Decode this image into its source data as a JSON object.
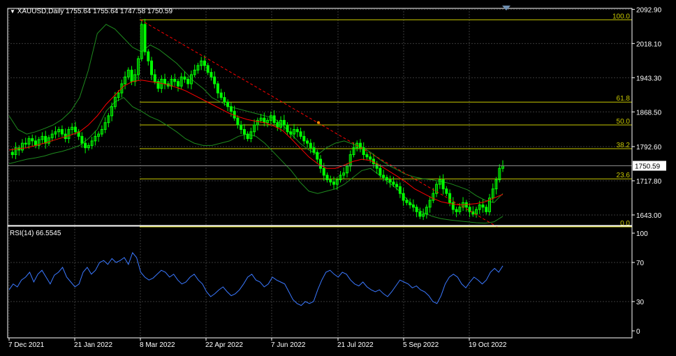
{
  "header": {
    "symbol_line": "XAUUSD,Daily  1755.64 1755.64 1747.58 1750.59",
    "menu_arrow": "▼"
  },
  "rsi_header": {
    "label": "RSI(14) 66.5545"
  },
  "colors": {
    "background": "#000000",
    "frame": "#ffffff",
    "grid": "#3a3a3a",
    "candle": "#00ff00",
    "ma": "#ff0000",
    "bands": "#1e8a1e",
    "fib": "#c8c800",
    "fib_label": "#c8c800",
    "trend": "#ff0000",
    "rsi": "#3a78ff",
    "price_box": "#ffffff",
    "text": "#ffffff"
  },
  "chart_data": [
    {
      "type": "candlestick",
      "title": "XAUUSD,Daily",
      "ohlc_last": {
        "open": 1755.64,
        "high": 1755.64,
        "low": 1747.58,
        "close": 1750.59
      },
      "y_ticks": [
        2092.9,
        2018.1,
        1943.3,
        1868.5,
        1792.6,
        1717.8,
        1643.0
      ],
      "y_tick_labels": [
        "2092.90",
        "2018.10",
        "1943.30",
        "1868.50",
        "1792.60",
        "1717.80",
        "1643.00"
      ],
      "ylim": [
        1620,
        2095
      ],
      "x_tick_labels": [
        "7 Dec 2021",
        "21 Jan 2022",
        "8 Mar 2022",
        "22 Apr 2022",
        "7 Jun 2022",
        "21 Jul 2022",
        "5 Sep 2022",
        "19 Oct 2022"
      ],
      "current_price_label": "1750.59",
      "current_price": 1750.59,
      "fibonacci": [
        {
          "level": "100.0",
          "price": 2070
        },
        {
          "level": "61.8",
          "price": 1890
        },
        {
          "level": "50.0",
          "price": 1840
        },
        {
          "level": "38.2",
          "price": 1788
        },
        {
          "level": "23.6",
          "price": 1722
        },
        {
          "level": "0.0",
          "price": 1617
        }
      ],
      "close_path": [
        1780,
        1775,
        1790,
        1785,
        1800,
        1798,
        1810,
        1805,
        1795,
        1808,
        1815,
        1800,
        1812,
        1820,
        1825,
        1830,
        1820,
        1810,
        1830,
        1835,
        1825,
        1815,
        1800,
        1790,
        1795,
        1805,
        1815,
        1820,
        1830,
        1845,
        1860,
        1880,
        1900,
        1910,
        1930,
        1945,
        1960,
        1935,
        1950,
        1985,
        2060,
        2000,
        1980,
        1950,
        1935,
        1920,
        1940,
        1930,
        1925,
        1940,
        1935,
        1925,
        1945,
        1940,
        1930,
        1950,
        1960,
        1970,
        1980,
        1970,
        1955,
        1945,
        1930,
        1910,
        1900,
        1890,
        1880,
        1870,
        1855,
        1840,
        1830,
        1820,
        1810,
        1825,
        1840,
        1850,
        1855,
        1845,
        1850,
        1860,
        1845,
        1835,
        1850,
        1840,
        1825,
        1820,
        1830,
        1825,
        1815,
        1805,
        1800,
        1790,
        1780,
        1765,
        1745,
        1730,
        1720,
        1715,
        1710,
        1720,
        1730,
        1735,
        1750,
        1775,
        1790,
        1800,
        1790,
        1775,
        1770,
        1765,
        1755,
        1745,
        1730,
        1725,
        1720,
        1715,
        1710,
        1705,
        1690,
        1675,
        1670,
        1665,
        1660,
        1650,
        1640,
        1645,
        1660,
        1675,
        1690,
        1710,
        1720,
        1700,
        1690,
        1670,
        1655,
        1650,
        1660,
        1670,
        1660,
        1650,
        1645,
        1655,
        1665,
        1660,
        1650,
        1680,
        1700,
        1720,
        1745,
        1750.59
      ],
      "ma_path": [
        1785,
        1788,
        1790,
        1795,
        1800,
        1806,
        1812,
        1818,
        1825,
        1840,
        1860,
        1885,
        1905,
        1925,
        1935,
        1938,
        1935,
        1932,
        1928,
        1922,
        1915,
        1905,
        1895,
        1885,
        1875,
        1865,
        1858,
        1852,
        1848,
        1845,
        1838,
        1828,
        1810,
        1790,
        1770,
        1755,
        1745,
        1745,
        1752,
        1760,
        1765,
        1762,
        1752,
        1740,
        1728,
        1715,
        1700,
        1690,
        1680,
        1672,
        1668,
        1665,
        1666,
        1668,
        1672,
        1680,
        1688
      ],
      "upper_band_path": [
        1860,
        1830,
        1820,
        1825,
        1832,
        1840,
        1852,
        1870,
        1900,
        1960,
        2040,
        2060,
        2050,
        2030,
        2010,
        2000,
        2015,
        2005,
        1990,
        1975,
        1955,
        1935,
        1920,
        1900,
        1890,
        1880,
        1875,
        1870,
        1865,
        1860,
        1855,
        1840,
        1820,
        1800,
        1785,
        1775,
        1790,
        1800,
        1805,
        1798,
        1792,
        1780,
        1765,
        1752,
        1742,
        1732,
        1726,
        1722,
        1720,
        1716,
        1712,
        1705,
        1698,
        1685,
        1675,
        1670,
        1690
      ],
      "lower_band_path": [
        1755,
        1760,
        1765,
        1768,
        1772,
        1778,
        1782,
        1788,
        1795,
        1810,
        1830,
        1870,
        1890,
        1900,
        1880,
        1870,
        1858,
        1850,
        1838,
        1825,
        1810,
        1800,
        1795,
        1795,
        1800,
        1805,
        1815,
        1820,
        1815,
        1800,
        1780,
        1760,
        1740,
        1715,
        1695,
        1690,
        1695,
        1700,
        1710,
        1725,
        1740,
        1745,
        1730,
        1715,
        1700,
        1680,
        1660,
        1648,
        1640,
        1635,
        1632,
        1630,
        1628,
        1626,
        1625,
        1628,
        1640
      ],
      "trend_line": {
        "from": [
          2070,
          "8 Mar 2022"
        ],
        "to": [
          1617,
          "19 Oct 2022"
        ]
      }
    },
    {
      "type": "line",
      "title": "RSI(14) 66.5545",
      "y_ticks": [
        100,
        70,
        30,
        0
      ],
      "y_tick_labels": [
        "100",
        "70",
        "30",
        "0"
      ],
      "ylim": [
        0,
        100
      ],
      "series": [
        {
          "values": [
            42,
            48,
            45,
            52,
            55,
            60,
            50,
            58,
            62,
            55,
            48,
            57,
            60,
            65,
            55,
            50,
            45,
            48,
            60,
            65,
            58,
            62,
            70,
            72,
            68,
            74,
            70,
            72,
            75,
            68,
            80,
            75,
            60,
            55,
            52,
            54,
            58,
            62,
            60,
            55,
            58,
            52,
            48,
            50,
            55,
            58,
            52,
            48,
            40,
            35,
            38,
            42,
            45,
            40,
            36,
            38,
            42,
            48,
            55,
            58,
            52,
            50,
            45,
            48,
            55,
            52,
            50,
            48,
            40,
            32,
            28,
            26,
            30,
            28,
            30,
            42,
            52,
            60,
            62,
            58,
            55,
            60,
            58,
            52,
            48,
            46,
            50,
            45,
            42,
            40,
            42,
            38,
            35,
            40,
            46,
            52,
            50,
            48,
            44,
            46,
            42,
            40,
            36,
            30,
            28,
            36,
            48,
            55,
            58,
            55,
            48,
            44,
            50,
            55,
            52,
            48,
            52,
            60,
            64,
            60,
            66.55
          ]
        }
      ]
    }
  ]
}
